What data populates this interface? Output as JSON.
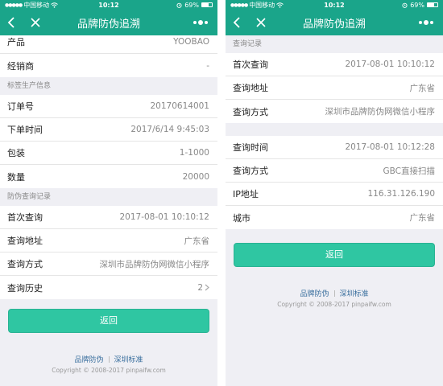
{
  "statusbar": {
    "carrier": "中国移动",
    "time": "10:12",
    "battery": "69%",
    "battery_level": 0.69
  },
  "navbar": {
    "title": "品牌防伪追溯"
  },
  "left": {
    "top_rows": [
      {
        "label": "产品",
        "value": "YOOBAO"
      },
      {
        "label": "经销商",
        "value": "-"
      }
    ],
    "label_section": {
      "header": "标签生产信息",
      "rows": [
        {
          "label": "订单号",
          "value": "20170614001"
        },
        {
          "label": "下单时间",
          "value": "2017/6/14 9:45:03"
        },
        {
          "label": "包装",
          "value": "1-1000"
        },
        {
          "label": "数量",
          "value": "20000"
        }
      ]
    },
    "query_section": {
      "header": "防伪查询记录",
      "rows": [
        {
          "label": "首次查询",
          "value": "2017-08-01 10:10:12"
        },
        {
          "label": "查询地址",
          "value": "广东省"
        },
        {
          "label": "查询方式",
          "value": "深圳市品牌防伪网微信小程序"
        }
      ],
      "history_label": "查询历史",
      "history_value": "2"
    },
    "return_label": "返回"
  },
  "right": {
    "section1": {
      "header": "查询记录",
      "rows": [
        {
          "label": "首次查询",
          "value": "2017-08-01 10:10:12"
        },
        {
          "label": "查询地址",
          "value": "广东省"
        },
        {
          "label": "查询方式",
          "value": "深圳市品牌防伪网微信小程序"
        }
      ]
    },
    "section2": {
      "rows": [
        {
          "label": "查询时间",
          "value": "2017-08-01 10:12:28"
        },
        {
          "label": "查询方式",
          "value": "GBC直接扫描"
        },
        {
          "label": "IP地址",
          "value": "116.31.126.190"
        },
        {
          "label": "城市",
          "value": "广东省"
        }
      ]
    },
    "return_label": "返回"
  },
  "footer": {
    "link1": "品牌防伪",
    "link2": "深圳标准",
    "copyright": "Copyright © 2008-2017 pinpaifw.com"
  },
  "colors": {
    "accent": "#1aa58a",
    "button": "#2fc6a2",
    "link": "#3a6f9e"
  },
  "icons": {
    "back": "chevron-left-icon",
    "close": "close-icon",
    "more": "more-icon",
    "wifi": "wifi-icon",
    "alarm": "alarm-icon",
    "history": "chevron-right-icon"
  }
}
